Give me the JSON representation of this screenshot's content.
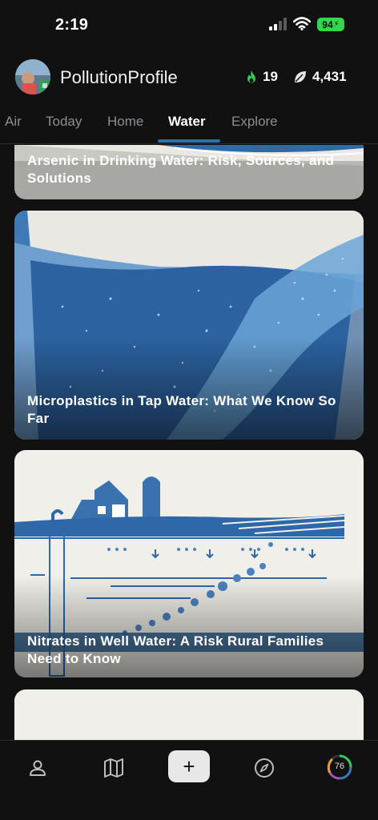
{
  "status_bar": {
    "time": "2:19",
    "battery": "94"
  },
  "header": {
    "app_title": "PollutionProfile",
    "streak_count": "19",
    "points": "4,431",
    "flame_color": "#34c759",
    "leaf_color": "#e5e5e5"
  },
  "tabs": [
    {
      "label": "Air",
      "active": false
    },
    {
      "label": "Today",
      "active": false
    },
    {
      "label": "Home",
      "active": false
    },
    {
      "label": "Water",
      "active": true
    },
    {
      "label": "Explore",
      "active": false
    }
  ],
  "articles": [
    {
      "title": "Arsenic in Drinking Water: Risk, Sources, and Solutions"
    },
    {
      "title": "Microplastics in Tap Water: What We Know So Far"
    },
    {
      "title": "Nitrates in Well Water: A Risk Rural Families Need to Know"
    }
  ],
  "bottom_nav": {
    "items": [
      "profile-icon",
      "map-icon",
      "add-icon",
      "compass-icon",
      "score-ring"
    ],
    "add_label": "+",
    "score": "76"
  },
  "colors": {
    "accent": "#2f6fae",
    "water_blue": "#3a78b5",
    "background": "#111111"
  }
}
